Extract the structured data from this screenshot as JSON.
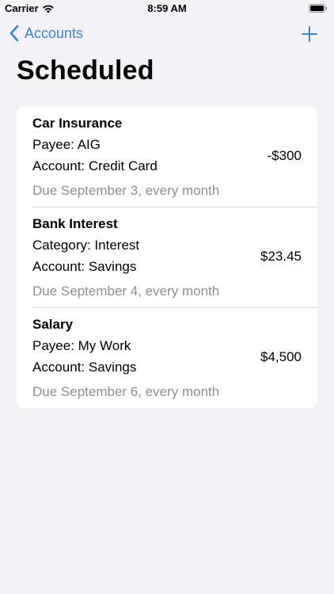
{
  "status_bar": {
    "carrier": "Carrier",
    "time": "8:59 AM",
    "wifi_icon": "wifi-icon",
    "battery_icon": "battery-icon"
  },
  "nav": {
    "back_label": "Accounts",
    "back_icon": "chevron-left-icon",
    "add_icon": "plus-icon"
  },
  "title": "Scheduled",
  "colors": {
    "accent": "#3b82d9",
    "background": "#f2f2f7",
    "secondary_text": "#8e8e93"
  },
  "scheduled": [
    {
      "name": "Car Insurance",
      "line1": "Payee: AIG",
      "line2": "Account: Credit Card",
      "due": "Due September 3, every month",
      "amount": "-$300"
    },
    {
      "name": "Bank Interest",
      "line1": "Category: Interest",
      "line2": "Account: Savings",
      "due": "Due September 4, every month",
      "amount": "$23.45"
    },
    {
      "name": "Salary",
      "line1": "Payee: My Work",
      "line2": "Account: Savings",
      "due": "Due September 6, every month",
      "amount": "$4,500"
    }
  ]
}
